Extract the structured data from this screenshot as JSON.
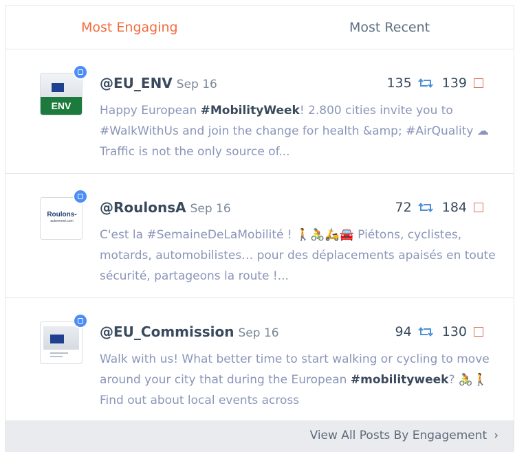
{
  "tabs": {
    "most_engaging": "Most Engaging",
    "most_recent": "Most Recent"
  },
  "posts": [
    {
      "handle": "@EU_ENV",
      "date": "Sep 16",
      "retweets": "135",
      "likes": "139",
      "avatar_text": "ENV",
      "text_pre": "Happy European ",
      "text_bold": "#MobilityWeek",
      "text_post": "! 2.800 cities invite you to #WalkWithUs and join the change for health &amp; #AirQuality ☁ Traffic is not the only source of..."
    },
    {
      "handle": "@RoulonsA",
      "date": "Sep 16",
      "retweets": "72",
      "likes": "184",
      "avatar_text": "Roulons-",
      "avatar_subtext": "autrement.com",
      "text": "C'est la #SemaineDeLaMobilité ! 🚶🚴🛵🚘 Piétons, cyclistes, motards, automobilistes… pour des déplacements apaisés en toute sécurité, partageons la route !..."
    },
    {
      "handle": "@EU_Commission",
      "date": "Sep 16",
      "retweets": "94",
      "likes": "130",
      "text_pre": "Walk with us! What better time to start walking or cycling to move around your city that during the European ",
      "text_bold": "#mobilityweek",
      "text_post": "? 🚴🚶 Find out about local events across"
    }
  ],
  "footer": {
    "link_label": "View All Posts By Engagement",
    "chevron": "›"
  },
  "colors": {
    "accent": "#f26b3a",
    "badge": "#4c8df6",
    "retweet": "#4a8fd8",
    "like": "#e06a5a",
    "body_text": "#8a95b8"
  }
}
